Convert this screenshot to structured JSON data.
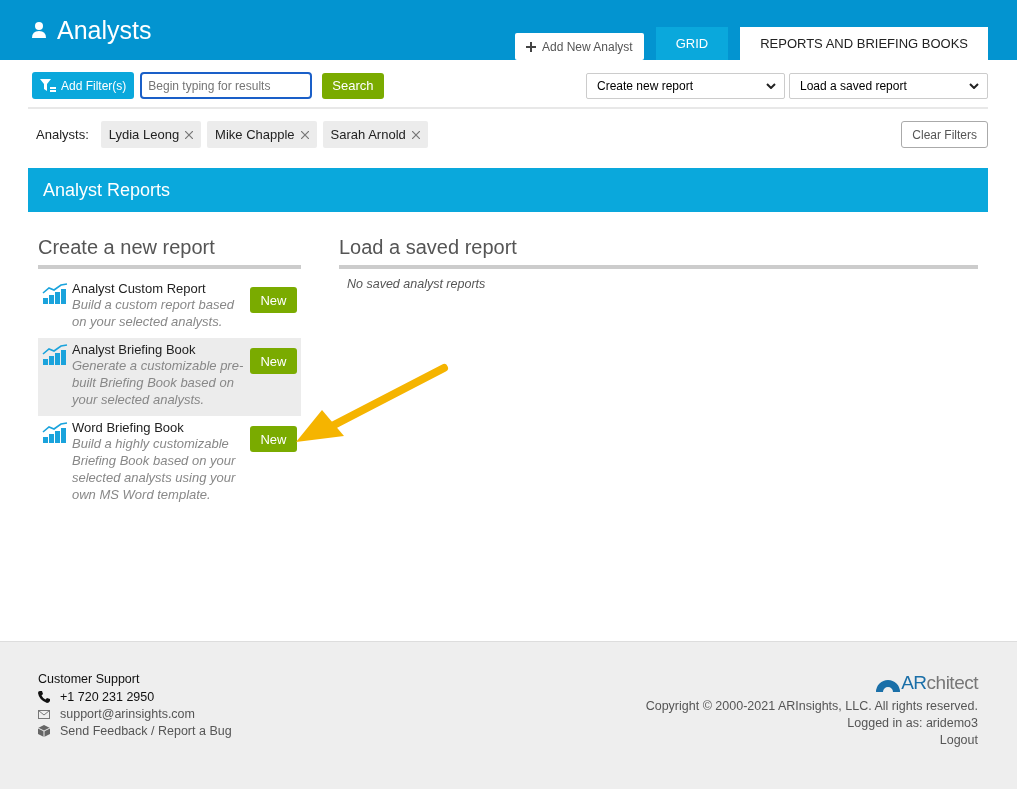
{
  "header": {
    "title": "Analysts",
    "add_button": "Add New Analyst"
  },
  "tabs": [
    {
      "label": "GRID",
      "selected": false
    },
    {
      "label": "REPORTS AND BRIEFING BOOKS",
      "selected": true
    }
  ],
  "toolbar": {
    "filter_button": "Add Filter(s)",
    "search": {
      "placeholder": "Begin typing for results"
    },
    "search_button": "Search",
    "create_select": "Create new report",
    "load_select": "Load a saved report"
  },
  "filters": {
    "label": "Analysts:",
    "chips": [
      "Lydia Leong",
      "Mike Chapple",
      "Sarah Arnold"
    ],
    "clear_button": "Clear Filters"
  },
  "section_title": "Analyst Reports",
  "create": {
    "heading": "Create a new report",
    "items": [
      {
        "title": "Analyst Custom Report",
        "description": "Build a custom report based on your selected analysts.",
        "button": "New",
        "selected": false
      },
      {
        "title": "Analyst Briefing Book",
        "description": "Generate a customizable pre-built Briefing Book based on your selected analysts.",
        "button": "New",
        "selected": true
      },
      {
        "title": "Word Briefing Book",
        "description": "Build a highly customizable Briefing Book based on your selected analysts using your own MS Word template.",
        "button": "New",
        "selected": false
      }
    ]
  },
  "load": {
    "heading": "Load a saved report",
    "empty": "No saved analyst reports"
  },
  "footer": {
    "support_title": "Customer Support",
    "phone": "+1 720 231 2950",
    "email": "support@arinsights.com",
    "feedback": "Send Feedback / Report a Bug",
    "logo": {
      "accent": "AR",
      "rest": "chitect"
    },
    "copyright": "Copyright © 2000-2021 ARInsights, LLC. All rights reserved.",
    "logged_in": "Logged in as: aridemo3",
    "logout": "Logout"
  }
}
